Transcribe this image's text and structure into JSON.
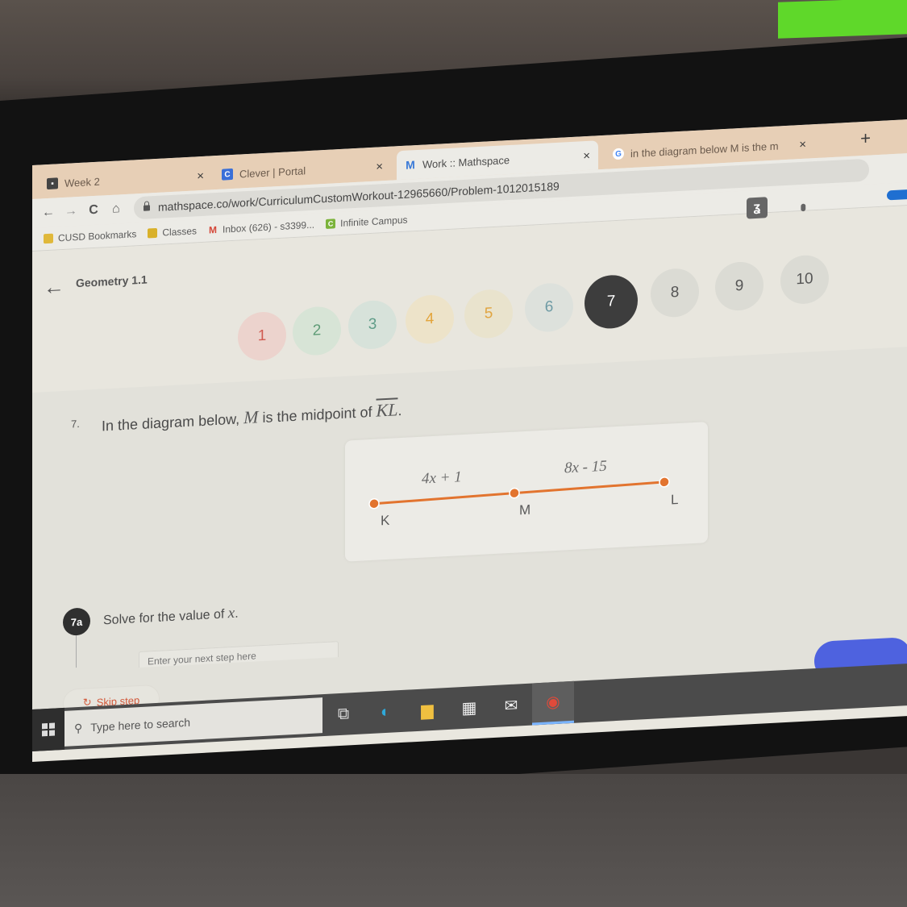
{
  "browser": {
    "tabs": [
      {
        "label": "Week 2",
        "icon": "classroom-icon",
        "active": false
      },
      {
        "label": "Clever | Portal",
        "icon": "clever-icon",
        "active": false
      },
      {
        "label": "Work :: Mathspace",
        "icon": "mathspace-icon",
        "active": true
      },
      {
        "label": "in the diagram below M is the m",
        "icon": "google-icon",
        "active": false
      }
    ],
    "new_tab_label": "+",
    "close_glyph": "×",
    "url": "mathspace.co/work/CurriculumCustomWorkout-12965660/Problem-1012015189",
    "nav": {
      "back": "←",
      "forward": "→",
      "reload": "C",
      "home": "⌂"
    },
    "bookmarks": [
      {
        "label": "CUSD Bookmarks",
        "icon": "folder-icon",
        "color": "#e0b83a"
      },
      {
        "label": "Classes",
        "icon": "classroom-icon",
        "color": "#d9b12a"
      },
      {
        "label": "Inbox (626) - s3399...",
        "icon": "gmail-icon",
        "color": "#d44638"
      },
      {
        "label": "Infinite Campus",
        "icon": "infinite-campus-icon",
        "color": "#7bb33a"
      }
    ]
  },
  "header": {
    "back_glyph": "←",
    "course_title": "Geometry 1.1",
    "app_icon_glyph": "ʓ",
    "menu_glyph": "•••"
  },
  "question_nav": {
    "current": 7,
    "items": [
      {
        "label": "1",
        "status": "incorrect",
        "bg": "#ecd3cd",
        "fg": "#d05a50"
      },
      {
        "label": "2",
        "status": "correct",
        "bg": "#d7e4d6",
        "fg": "#5f9c77"
      },
      {
        "label": "3",
        "status": "correct",
        "bg": "#d7e2da",
        "fg": "#5f9c88"
      },
      {
        "label": "4",
        "status": "partial",
        "bg": "#ede3c9",
        "fg": "#e3a43a"
      },
      {
        "label": "5",
        "status": "partial",
        "bg": "#e9e3cd",
        "fg": "#e0a440"
      },
      {
        "label": "6",
        "status": "viewed",
        "bg": "#dde1dc",
        "fg": "#6d9aa4"
      },
      {
        "label": "7",
        "status": "current",
        "bg": "#3d3d3d",
        "fg": "#ffffff"
      },
      {
        "label": "8",
        "status": "unvisited",
        "bg": "#dbdbd4",
        "fg": "#555555"
      },
      {
        "label": "9",
        "status": "unvisited",
        "bg": "#dbdbd4",
        "fg": "#555555"
      },
      {
        "label": "10",
        "status": "unvisited",
        "bg": "#dbdbd4",
        "fg": "#555555"
      }
    ]
  },
  "question": {
    "number": "7.",
    "text_before": "In the diagram below, ",
    "var_m": "M",
    "text_middle": " is the midpoint of ",
    "segment": "KL",
    "text_after": ".",
    "diagram": {
      "segment_color": "#e2742f",
      "points": [
        {
          "label": "K"
        },
        {
          "label": "M"
        },
        {
          "label": "L"
        }
      ],
      "km_label": "4x + 1",
      "ml_label": "8x - 15"
    }
  },
  "step": {
    "badge": "7a",
    "text_before": "Solve for the value of ",
    "var": "x",
    "text_after": ".",
    "input_placeholder": "Enter your next step here",
    "input_value": "",
    "skip_label": "Skip step",
    "skip_icon": "↻"
  },
  "taskbar": {
    "search_placeholder": "Type here to search",
    "search_glyph": "⚲",
    "apps": [
      {
        "name": "task-view-icon",
        "glyph": "⧉"
      },
      {
        "name": "edge-icon",
        "glyph": "◐",
        "color": "#2fa9d9"
      },
      {
        "name": "file-explorer-icon",
        "glyph": "▆",
        "color": "#f0c040"
      },
      {
        "name": "store-icon",
        "glyph": "▦",
        "color": "#f0f0f0"
      },
      {
        "name": "mail-icon",
        "glyph": "✉",
        "color": "#f0f0f0"
      },
      {
        "name": "chrome-icon",
        "glyph": "◉",
        "color": "#e04a3a",
        "active": true
      }
    ]
  }
}
